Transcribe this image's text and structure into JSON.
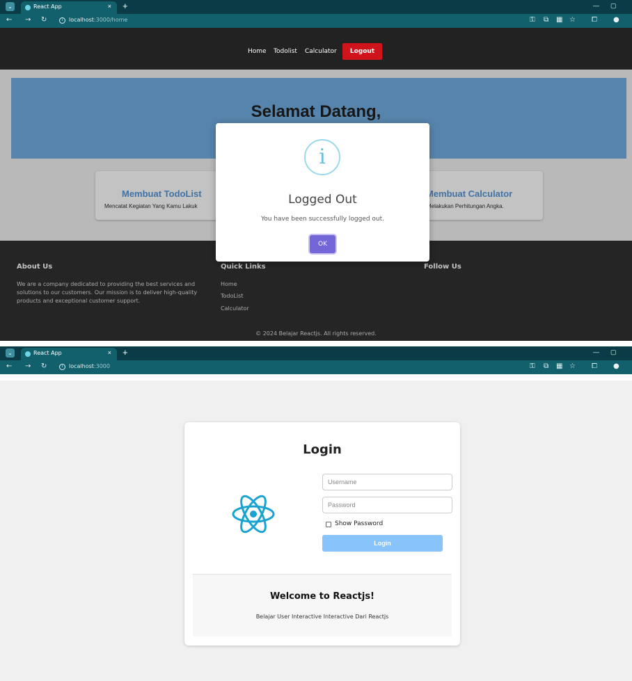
{
  "browser_home": {
    "tab_title": "React App",
    "tab_close": "×",
    "tab_new": "+",
    "url_host": "localhost",
    "url_path": ":3000/home"
  },
  "navbar": {
    "links": [
      "Home",
      "Todolist",
      "Calculator"
    ],
    "logout_label": "Logout",
    "logout_color": "#d0141c"
  },
  "home": {
    "hero_title": "Selamat Datang,",
    "cards": [
      {
        "title": "Membuat TodoList",
        "desc": "Mencatat Kegiatan Yang Kamu Lakuk"
      },
      {
        "title": "Membuat Calculator",
        "desc": "Melakukan Perhitungan Angka."
      }
    ]
  },
  "footer": {
    "about_heading": "About Us",
    "about_text": "We are a company dedicated to providing the best services and solutions to our customers. Our mission is to deliver high-quality products and exceptional customer support.",
    "links_heading": "Quick Links",
    "links": [
      "Home",
      "TodoList",
      "Calculator"
    ],
    "follow_heading": "Follow Us",
    "copyright": "© 2024 Belajar Reactjs. All rights reserved."
  },
  "modal": {
    "icon": "info-icon",
    "title": "Logged Out",
    "message": "You have been successfully logged out.",
    "ok_label": "OK",
    "ok_color": "#7366d9"
  },
  "browser_login": {
    "tab_title": "React App",
    "tab_close": "×",
    "tab_new": "+",
    "url_host": "localhost",
    "url_path": ":3000"
  },
  "login": {
    "title": "Login",
    "username_placeholder": "Username",
    "password_placeholder": "Password",
    "show_password_label": "Show Password",
    "login_button": "Login",
    "login_button_color": "#88c4fa",
    "welcome_title": "Welcome to Reactjs!",
    "welcome_sub": "Belajar User Interactive Interactive Dari Reactjs"
  }
}
